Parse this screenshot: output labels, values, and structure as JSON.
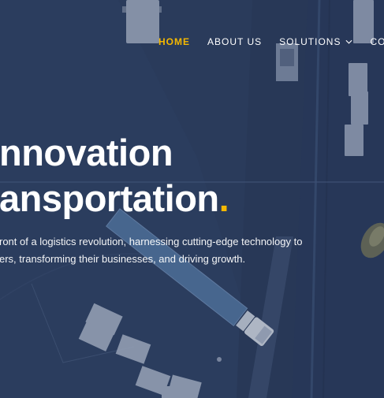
{
  "nav": {
    "items": [
      {
        "label": "HOME",
        "active": true
      },
      {
        "label": "ABOUT US",
        "active": false
      },
      {
        "label": "SOLUTIONS",
        "active": false,
        "has_dropdown": true
      },
      {
        "label": "CONTA",
        "active": false
      }
    ]
  },
  "hero": {
    "title_line1": "nnovation",
    "title_line2": "ansportation",
    "title_period": ".",
    "subtitle_line1": "ront of a logistics revolution, harnessing cutting-edge technology to",
    "subtitle_line2": "ers, transforming their businesses, and driving growth."
  },
  "colors": {
    "accent": "#f5b800",
    "background": "#2c3e5d",
    "text": "#ffffff"
  },
  "icons": {
    "dropdown": "chevron-down-icon"
  }
}
